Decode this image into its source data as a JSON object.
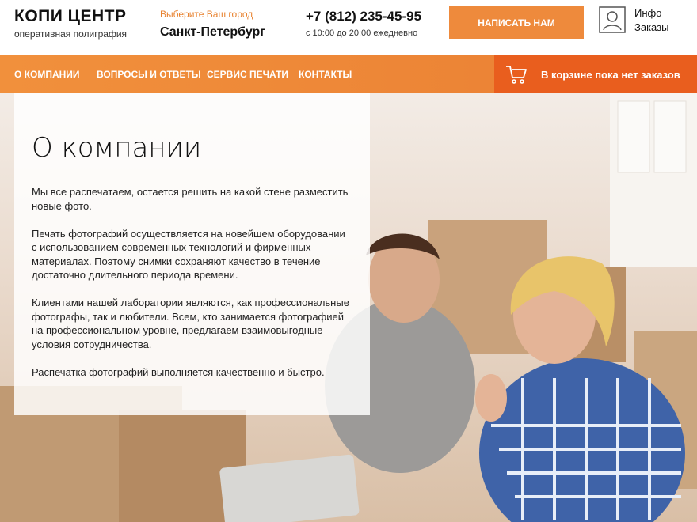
{
  "header": {
    "logo_title": "КОПИ ЦЕНТР",
    "logo_subtitle": "оперативная полиграфия",
    "city_choose": "Выберите Ваш город",
    "city_name": "Санкт-Петербург",
    "phone": "+7 (812) 235-45-95",
    "hours": "с 10:00 до 20:00 ежедневно",
    "write_button": "НАПИСАТЬ НАМ",
    "user_links": [
      "Инфо",
      "Заказы"
    ]
  },
  "nav": {
    "items": [
      {
        "label": "О КОМПАНИИ"
      },
      {
        "label": "ВОПРОСЫ И ОТВЕТЫ"
      },
      {
        "label": "СЕРВИС ПЕЧАТИ"
      },
      {
        "label": "КОНТАКТЫ"
      }
    ],
    "cart_text": "В корзине пока нет заказов"
  },
  "content": {
    "title": "О компании",
    "paragraphs": [
      "Мы все распечатаем, остается решить на какой стене разместить новые фото.",
      "Печать фотографий осуществляется на новейшем оборудовании с использованием современных технологий и фирменных материалах. Поэтому снимки сохраняют качество в течение достаточно длительного периода времени.",
      "Клиентами нашей лаборатории являются, как профессиональные фотографы, так и любители. Всем, кто занимается фотографией на профессиональном уровне, предлагаем взаимовыгодные условия сотрудничества.",
      "Распечатка фотографий выполняется качественно и быстро."
    ]
  },
  "colors": {
    "accent": "#ee8a3c",
    "nav": "#ea7f33",
    "cart": "#e95e1e"
  },
  "icons": {
    "user": "user-icon",
    "cart": "cart-icon"
  }
}
